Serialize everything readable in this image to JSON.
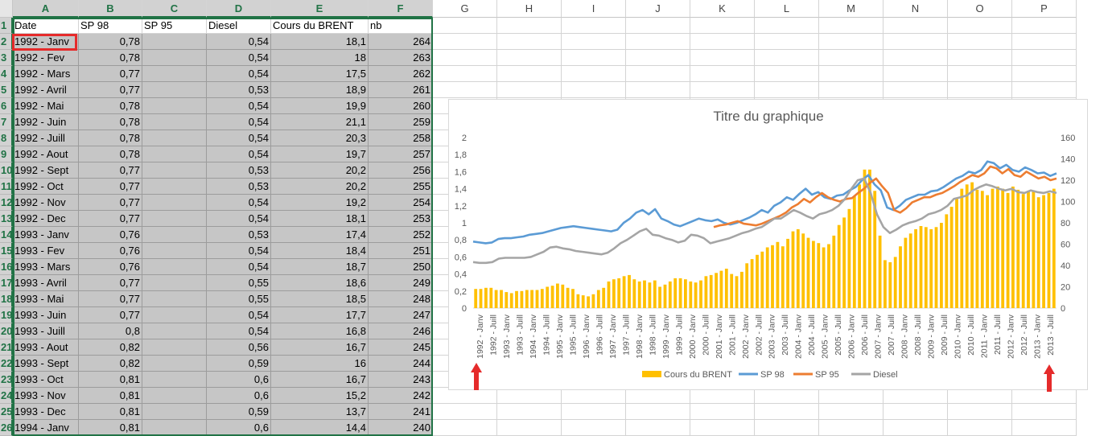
{
  "spreadsheet": {
    "columns": [
      "A",
      "B",
      "C",
      "D",
      "E",
      "F",
      "G",
      "H",
      "I",
      "J",
      "K",
      "L",
      "M",
      "N",
      "O",
      "P"
    ],
    "header_row": [
      "Date",
      "SP 98",
      "SP 95",
      "Diesel",
      "Cours du BRENT",
      "nb"
    ],
    "row_numbers": [
      "1",
      "2",
      "3",
      "4",
      "5",
      "6",
      "7",
      "8",
      "9",
      "10",
      "11",
      "12",
      "13",
      "14",
      "15",
      "16",
      "17",
      "18",
      "19",
      "20",
      "21",
      "22",
      "23",
      "24",
      "25",
      "26"
    ],
    "rows": [
      [
        "1992 - Janv",
        "0,78",
        "",
        "0,54",
        "18,1",
        "264"
      ],
      [
        "1992 - Fev",
        "0,78",
        "",
        "0,54",
        "18",
        "263"
      ],
      [
        "1992 - Mars",
        "0,77",
        "",
        "0,54",
        "17,5",
        "262"
      ],
      [
        "1992 - Avril",
        "0,77",
        "",
        "0,53",
        "18,9",
        "261"
      ],
      [
        "1992 - Mai",
        "0,78",
        "",
        "0,54",
        "19,9",
        "260"
      ],
      [
        "1992 - Juin",
        "0,78",
        "",
        "0,54",
        "21,1",
        "259"
      ],
      [
        "1992 - Juill",
        "0,78",
        "",
        "0,54",
        "20,3",
        "258"
      ],
      [
        "1992 - Aout",
        "0,78",
        "",
        "0,54",
        "19,7",
        "257"
      ],
      [
        "1992 - Sept",
        "0,77",
        "",
        "0,53",
        "20,2",
        "256"
      ],
      [
        "1992 - Oct",
        "0,77",
        "",
        "0,53",
        "20,2",
        "255"
      ],
      [
        "1992 - Nov",
        "0,77",
        "",
        "0,54",
        "19,2",
        "254"
      ],
      [
        "1992 - Dec",
        "0,77",
        "",
        "0,54",
        "18,1",
        "253"
      ],
      [
        "1993 - Janv",
        "0,76",
        "",
        "0,53",
        "17,4",
        "252"
      ],
      [
        "1993 - Fev",
        "0,76",
        "",
        "0,54",
        "18,4",
        "251"
      ],
      [
        "1993 - Mars",
        "0,76",
        "",
        "0,54",
        "18,7",
        "250"
      ],
      [
        "1993 - Avril",
        "0,77",
        "",
        "0,55",
        "18,6",
        "249"
      ],
      [
        "1993 - Mai",
        "0,77",
        "",
        "0,55",
        "18,5",
        "248"
      ],
      [
        "1993 - Juin",
        "0,77",
        "",
        "0,54",
        "17,7",
        "247"
      ],
      [
        "1993 - Juill",
        "0,8",
        "",
        "0,54",
        "16,8",
        "246"
      ],
      [
        "1993 - Aout",
        "0,82",
        "",
        "0,56",
        "16,7",
        "245"
      ],
      [
        "1993 - Sept",
        "0,82",
        "",
        "0,59",
        "16",
        "244"
      ],
      [
        "1993 - Oct",
        "0,81",
        "",
        "0,6",
        "16,7",
        "243"
      ],
      [
        "1993 - Nov",
        "0,81",
        "",
        "0,6",
        "15,2",
        "242"
      ],
      [
        "1993 - Dec",
        "0,81",
        "",
        "0,59",
        "13,7",
        "241"
      ],
      [
        "1994 - Janv",
        "0,81",
        "",
        "0,6",
        "14,4",
        "240"
      ]
    ],
    "active_cell": "A2",
    "accent_color": "#217346",
    "highlight_color": "#e52b2b"
  },
  "chart_data": {
    "type": "line",
    "title": "Titre du graphique",
    "primary_axis_ticks": [
      "0",
      "0,2",
      "0,4",
      "0,6",
      "0,8",
      "1",
      "1,2",
      "1,4",
      "1,6",
      "1,8",
      "2"
    ],
    "secondary_axis_ticks": [
      "0",
      "20",
      "40",
      "60",
      "80",
      "100",
      "120",
      "140",
      "160"
    ],
    "ylim": [
      0,
      2
    ],
    "y2lim": [
      0,
      160
    ],
    "x_tick_labels": [
      "1992 - Janv",
      "1992 - Juill",
      "1993 - Janv",
      "1993 - Juill",
      "1994 - Janv",
      "1994 - Juill",
      "1995 - Janv",
      "1995 - Juill",
      "1996 - Janv",
      "1996 - Juill",
      "1997 - Janv",
      "1997 - Juill",
      "1998 - Janv",
      "1998 - Juill",
      "1999 - Janv",
      "1999 - Juill",
      "2000 - Janv",
      "2000 - Juill",
      "2001 - Janv",
      "2001 - Juill",
      "2002 - Janv",
      "2002 - Juill",
      "2003 - Janv",
      "2003 - Juill",
      "2004 - Janv",
      "2004 - Juill",
      "2005 - Janv",
      "2005 - Juill",
      "2006 - Janv",
      "2006 - Juill",
      "2007 - Janv",
      "2007 - Juill",
      "2008 - Janv",
      "2008 - Juill",
      "2009 - Janv",
      "2009 - Juill",
      "2010 - Janv",
      "2010 - Juill",
      "2011 - Janv",
      "2011 - Juill",
      "2012 - Janv",
      "2012 - Juill",
      "2013 - Janv",
      "2013 - Juill"
    ],
    "series": [
      {
        "name": "Cours du BRENT",
        "type": "bar",
        "axis": "secondary",
        "color": "#ffc000",
        "values": [
          18,
          18,
          19,
          19,
          17,
          17,
          15,
          14,
          16,
          16,
          17,
          17,
          17,
          18,
          20,
          21,
          23,
          22,
          19,
          18,
          13,
          12,
          11,
          13,
          17,
          19,
          25,
          27,
          28,
          30,
          31,
          27,
          25,
          26,
          24,
          26,
          20,
          22,
          25,
          28,
          28,
          27,
          25,
          24,
          26,
          30,
          31,
          33,
          35,
          37,
          32,
          30,
          34,
          42,
          46,
          50,
          53,
          57,
          59,
          62,
          58,
          65,
          72,
          74,
          70,
          66,
          63,
          61,
          57,
          60,
          68,
          78,
          85,
          93,
          105,
          116,
          130,
          130,
          110,
          68,
          45,
          43,
          48,
          58,
          66,
          70,
          74,
          77,
          76,
          74,
          76,
          80,
          88,
          95,
          103,
          112,
          116,
          118,
          111,
          110,
          106,
          112,
          114,
          112,
          108,
          114,
          111,
          107,
          110,
          110,
          104,
          106,
          108,
          112
        ]
      },
      {
        "name": "SP 98",
        "type": "line",
        "axis": "primary",
        "color": "#5b9bd5",
        "values": [
          0.78,
          0.77,
          0.76,
          0.77,
          0.81,
          0.82,
          0.82,
          0.83,
          0.84,
          0.86,
          0.87,
          0.88,
          0.9,
          0.92,
          0.94,
          0.95,
          0.96,
          0.95,
          0.94,
          0.93,
          0.92,
          0.91,
          0.9,
          0.92,
          1.0,
          1.05,
          1.12,
          1.15,
          1.1,
          1.16,
          1.05,
          1.02,
          0.98,
          0.96,
          0.99,
          1.02,
          1.05,
          1.03,
          1.02,
          1.04,
          1.0,
          0.98,
          1.0,
          1.03,
          1.06,
          1.1,
          1.15,
          1.12,
          1.2,
          1.24,
          1.3,
          1.27,
          1.34,
          1.4,
          1.33,
          1.36,
          1.3,
          1.28,
          1.32,
          1.33,
          1.38,
          1.42,
          1.5,
          1.56,
          1.45,
          1.38,
          1.18,
          1.15,
          1.2,
          1.27,
          1.3,
          1.33,
          1.33,
          1.37,
          1.38,
          1.42,
          1.47,
          1.52,
          1.55,
          1.6,
          1.58,
          1.62,
          1.72,
          1.7,
          1.64,
          1.68,
          1.62,
          1.6,
          1.65,
          1.62,
          1.58,
          1.59,
          1.55,
          1.58
        ]
      },
      {
        "name": "SP 95",
        "type": "line",
        "axis": "primary",
        "color": "#ed7d31",
        "values": [
          null,
          null,
          null,
          null,
          null,
          null,
          null,
          null,
          null,
          null,
          null,
          null,
          null,
          null,
          null,
          null,
          null,
          null,
          null,
          null,
          null,
          null,
          null,
          null,
          null,
          null,
          null,
          null,
          null,
          null,
          null,
          null,
          null,
          null,
          null,
          null,
          null,
          null,
          null,
          null,
          0.95,
          0.97,
          0.98,
          1.0,
          1.02,
          0.99,
          0.98,
          0.97,
          0.99,
          1.02,
          1.05,
          1.08,
          1.12,
          1.18,
          1.22,
          1.28,
          1.24,
          1.3,
          1.35,
          1.3,
          1.27,
          1.25,
          1.28,
          1.29,
          1.35,
          1.4,
          1.47,
          1.52,
          1.43,
          1.35,
          1.15,
          1.12,
          1.17,
          1.24,
          1.27,
          1.3,
          1.3,
          1.33,
          1.35,
          1.39,
          1.43,
          1.48,
          1.52,
          1.56,
          1.54,
          1.58,
          1.66,
          1.64,
          1.58,
          1.63,
          1.56,
          1.54,
          1.6,
          1.56,
          1.52,
          1.54,
          1.5,
          1.52
        ]
      },
      {
        "name": "Diesel",
        "type": "line",
        "axis": "primary",
        "color": "#a5a5a5",
        "values": [
          0.54,
          0.53,
          0.53,
          0.54,
          0.58,
          0.59,
          0.59,
          0.59,
          0.59,
          0.6,
          0.63,
          0.66,
          0.71,
          0.72,
          0.7,
          0.69,
          0.67,
          0.66,
          0.65,
          0.64,
          0.63,
          0.65,
          0.7,
          0.76,
          0.8,
          0.85,
          0.9,
          0.93,
          0.86,
          0.85,
          0.82,
          0.8,
          0.77,
          0.79,
          0.86,
          0.85,
          0.82,
          0.76,
          0.78,
          0.8,
          0.82,
          0.85,
          0.88,
          0.9,
          0.93,
          0.95,
          1.0,
          1.05,
          1.05,
          1.1,
          1.15,
          1.12,
          1.08,
          1.05,
          1.1,
          1.12,
          1.15,
          1.2,
          1.28,
          1.4,
          1.5,
          1.52,
          1.35,
          1.1,
          0.95,
          0.88,
          0.92,
          0.97,
          1.0,
          1.02,
          1.05,
          1.1,
          1.12,
          1.15,
          1.2,
          1.28,
          1.3,
          1.32,
          1.38,
          1.42,
          1.45,
          1.43,
          1.4,
          1.38,
          1.4,
          1.36,
          1.35,
          1.38,
          1.36,
          1.35,
          1.37,
          1.35
        ]
      }
    ],
    "legend": {
      "position": "bottom",
      "items": [
        "Cours du BRENT",
        "SP 98",
        "SP 95",
        "Diesel"
      ]
    },
    "grid": false
  },
  "annotations": {
    "arrow_color": "#e52b2b"
  }
}
